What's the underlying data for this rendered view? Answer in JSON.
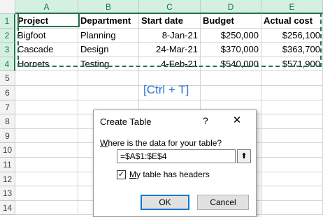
{
  "columns": [
    "A",
    "B",
    "C",
    "D",
    "E"
  ],
  "rows": [
    "1",
    "2",
    "3",
    "4",
    "5",
    "6",
    "7",
    "8",
    "9",
    "10",
    "11",
    "12",
    "13",
    "14"
  ],
  "table": {
    "header": [
      "Project",
      "Department",
      "Start date",
      "Budget",
      "Actual cost"
    ],
    "data": [
      [
        "Bigfoot",
        "Planning",
        "8-Jan-21",
        "$250,000",
        "$256,100"
      ],
      [
        "Cascade",
        "Design",
        "24-Mar-21",
        "$370,000",
        "$363,700"
      ],
      [
        "Hornets",
        "Testing",
        "4-Feb-21",
        "$540,000",
        "$571,900"
      ]
    ]
  },
  "shortcut_label": "[Ctrl + T]",
  "dialog": {
    "title": "Create Table",
    "help": "?",
    "close": "✕",
    "question_underlined": "W",
    "question_rest": "here is the data for your table?",
    "range_value": "=$A$1:$E$4",
    "collapse_icon": "⬆",
    "checkbox_checked": true,
    "checkbox_mark": "✓",
    "checkbox_label_underlined": "M",
    "checkbox_label_rest": "y table has headers",
    "ok_label": "OK",
    "cancel_label": "Cancel"
  },
  "colors": {
    "selection_green": "#217346",
    "shortcut_blue": "#2e74d2"
  }
}
